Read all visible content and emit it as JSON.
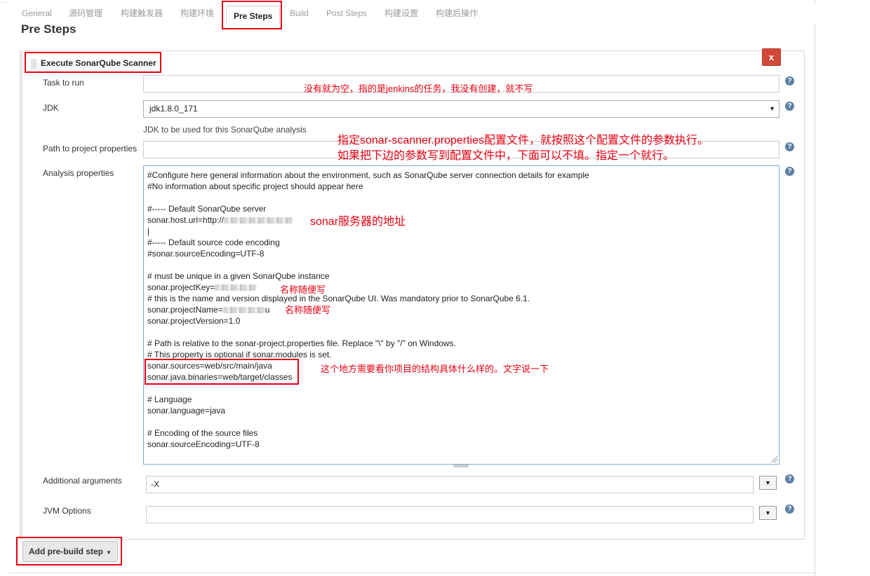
{
  "tabs": [
    "General",
    "源码管理",
    "构建触发器",
    "构建环境",
    "Pre Steps",
    "Build",
    "Post Steps",
    "构建设置",
    "构建后操作"
  ],
  "active_tab": "Pre Steps",
  "section_title": "Pre Steps",
  "step": {
    "title": "Execute SonarQube Scanner",
    "delete_label": "x"
  },
  "fields": {
    "task_to_run": {
      "label": "Task to run",
      "value": ""
    },
    "jdk": {
      "label": "JDK",
      "value": "jdk1.8.0_171",
      "hint": "JDK to be used for this SonarQube analysis"
    },
    "path_to_project_properties": {
      "label": "Path to project properties",
      "value": ""
    },
    "analysis_properties": {
      "label": "Analysis properties",
      "lines": [
        "#Configure here general information about the environment, such as SonarQube server connection details for example",
        "#No information about specific project should appear here",
        "",
        "#----- Default SonarQube server",
        "sonar.host.url=http://",
        "|",
        "#----- Default source code encoding",
        "#sonar.sourceEncoding=UTF-8",
        "",
        "# must be unique in a given SonarQube instance",
        "sonar.projectKey=",
        "# this is the name and version displayed in the SonarQube UI. Was mandatory prior to SonarQube 6.1.",
        "sonar.projectName=",
        "sonar.projectVersion=1.0",
        "",
        "# Path is relative to the sonar-project.properties file. Replace \"\\\" by \"/\" on Windows.",
        "# This property is optional if sonar.modules is set.",
        "sonar.sources=web/src/main/java",
        "sonar.java.binaries=web/target/classes",
        "",
        "# Language",
        "sonar.language=java",
        "",
        "# Encoding of the source files",
        "sonar.sourceEncoding=UTF-8"
      ],
      "project_name_suffix": "u"
    },
    "additional_arguments": {
      "label": "Additional arguments",
      "value": "-X"
    },
    "jvm_options": {
      "label": "JVM Options",
      "value": ""
    }
  },
  "add_button_label": "Add pre-build step",
  "annotations": {
    "task_note": "没有就为空，指的是jenkins的任务，我没有创建，就不写",
    "properties_note_1": "指定sonar-scanner.properties配置文件，就按照这个配置文件的参数执行。",
    "properties_note_2": "如果把下边的参数写到配置文件中，下面可以不填。指定一个就行。",
    "sonar_url_note": "sonar服务器的地址",
    "project_key_note": "名称随便写",
    "project_name_note": "名称随便写",
    "sources_note": "这个地方需要看你项目的结构具体什么样的。文字说一下"
  },
  "colors": {
    "annotation_red": "#e60012",
    "delete_red": "#d24939",
    "help_blue": "#5b7fa3"
  },
  "icons": {
    "help": "question-circle-icon",
    "dropdown": "caret-down-icon",
    "drag": "drag-handle-icon"
  }
}
